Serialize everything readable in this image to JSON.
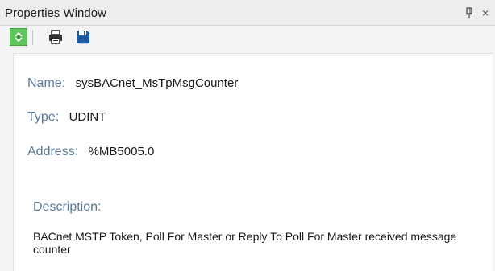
{
  "window": {
    "title": "Properties Window",
    "pin_glyph": "Ѩ",
    "close_glyph": "×"
  },
  "toolbar": {
    "buttons": [
      {
        "icon": "sort-icon"
      },
      {
        "icon": "print-icon"
      },
      {
        "icon": "save-icon"
      }
    ]
  },
  "properties": {
    "name_label": "Name:",
    "name_value": "sysBACnet_MsTpMsgCounter",
    "type_label": "Type:",
    "type_value": "UDINT",
    "address_label": "Address:",
    "address_value": "%MB5005.0",
    "description_label": "Description:",
    "description_value": "BACnet MSTP Token, Poll For Master or Reply To Poll For Master received message counter"
  },
  "colors": {
    "label": "#5a7a9a",
    "sort_button": "#5cc55c",
    "save_icon": "#1f5fa8"
  }
}
